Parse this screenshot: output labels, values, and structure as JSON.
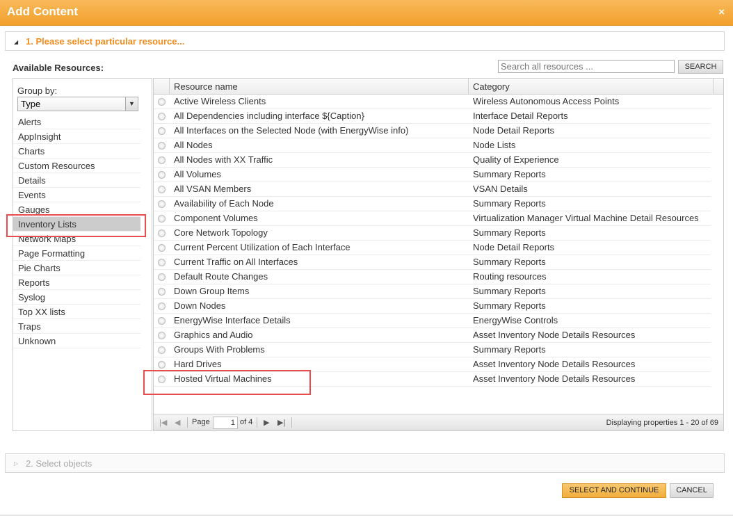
{
  "dialog": {
    "title": "Add Content",
    "close_icon": "×"
  },
  "step1": {
    "label": "1. Please select particular resource...",
    "available_label": "Available Resources:"
  },
  "search": {
    "placeholder": "Search all resources ...",
    "button": "SEARCH"
  },
  "groupby": {
    "label": "Group by:",
    "selected": "Type",
    "types": [
      "Alerts",
      "AppInsight",
      "Charts",
      "Custom Resources",
      "Details",
      "Events",
      "Gauges",
      "Inventory Lists",
      "Network Maps",
      "Page Formatting",
      "Pie Charts",
      "Reports",
      "Syslog",
      "Top XX lists",
      "Traps",
      "Unknown"
    ],
    "selected_type": "Inventory Lists"
  },
  "grid": {
    "columns": [
      "Resource name",
      "Category"
    ],
    "rows": [
      [
        "Active Wireless Clients",
        "Wireless Autonomous Access Points"
      ],
      [
        "All Dependencies including interface ${Caption}",
        "Interface Detail Reports"
      ],
      [
        "All Interfaces on the Selected Node (with EnergyWise info)",
        "Node Detail Reports"
      ],
      [
        "All Nodes",
        "Node Lists"
      ],
      [
        "All Nodes with XX Traffic",
        "Quality of Experience"
      ],
      [
        "All Volumes",
        "Summary Reports"
      ],
      [
        "All VSAN Members",
        "VSAN Details"
      ],
      [
        "Availability of Each Node",
        "Summary Reports"
      ],
      [
        "Component Volumes",
        "Virtualization Manager Virtual Machine Detail Resources"
      ],
      [
        "Core Network Topology",
        "Summary Reports"
      ],
      [
        "Current Percent Utilization of Each Interface",
        "Node Detail Reports"
      ],
      [
        "Current Traffic on All Interfaces",
        "Summary Reports"
      ],
      [
        "Default Route Changes",
        "Routing resources"
      ],
      [
        "Down Group Items",
        "Summary Reports"
      ],
      [
        "Down Nodes",
        "Summary Reports"
      ],
      [
        "EnergyWise Interface Details",
        "EnergyWise Controls"
      ],
      [
        "Graphics and Audio",
        "Asset Inventory Node Details Resources"
      ],
      [
        "Groups With Problems",
        "Summary Reports"
      ],
      [
        "Hard Drives",
        "Asset Inventory Node Details Resources"
      ],
      [
        "Hosted Virtual Machines",
        "Asset Inventory Node Details Resources"
      ]
    ]
  },
  "pager": {
    "page_label": "Page",
    "page": "1",
    "of_label": "of 4",
    "display": "Displaying properties 1 - 20 of 69"
  },
  "step2": {
    "label": "2. Select objects"
  },
  "buttons": {
    "select": "SELECT AND CONTINUE",
    "cancel": "CANCEL"
  },
  "colors": {
    "accent": "#f3a02b",
    "step_text": "#f08c1d",
    "highlight": "#e84c4c"
  }
}
